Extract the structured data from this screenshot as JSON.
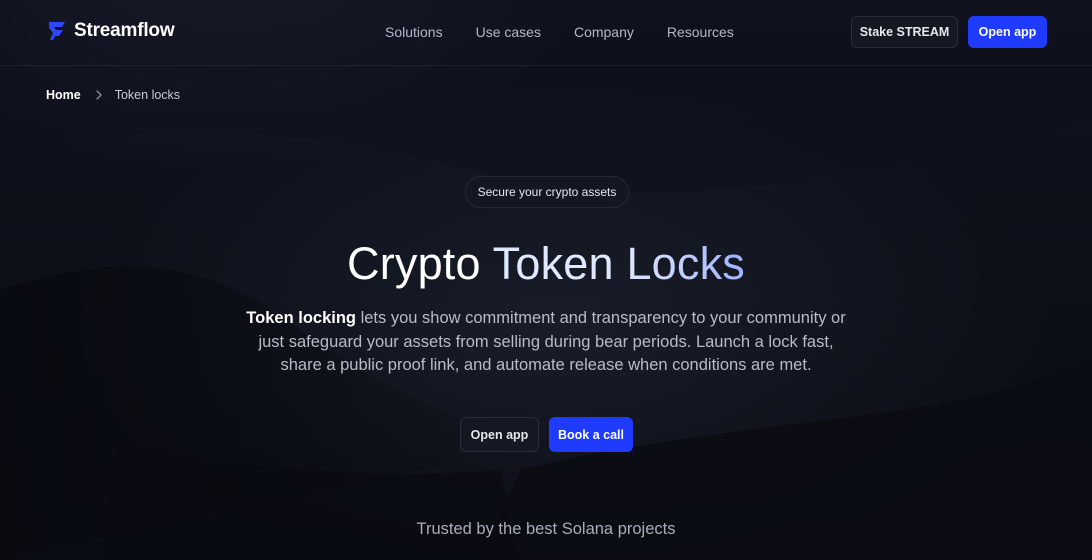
{
  "brand": {
    "name": "Streamflow",
    "accent": "#1f3bff"
  },
  "nav": {
    "items": [
      {
        "label": "Solutions"
      },
      {
        "label": "Use cases"
      },
      {
        "label": "Company"
      },
      {
        "label": "Resources"
      }
    ],
    "stake_label": "Stake STREAM",
    "open_app_label": "Open app"
  },
  "breadcrumb": {
    "home": "Home",
    "separator_icon": "chevron-right-icon",
    "current": "Token locks"
  },
  "hero": {
    "pill": "Secure your crypto assets",
    "title_part1": "Crypto ",
    "title_part2": "Token ",
    "title_part3": "Locks",
    "description_bold": "Token locking",
    "description_rest": " lets you show commitment and transparency to your community or just safeguard your assets from selling during bear periods. Launch a lock fast, share a public proof link, and automate release when conditions are met.",
    "open_app_label": "Open app",
    "book_call_label": "Book a call"
  },
  "trusted": "Trusted by the best Solana projects"
}
